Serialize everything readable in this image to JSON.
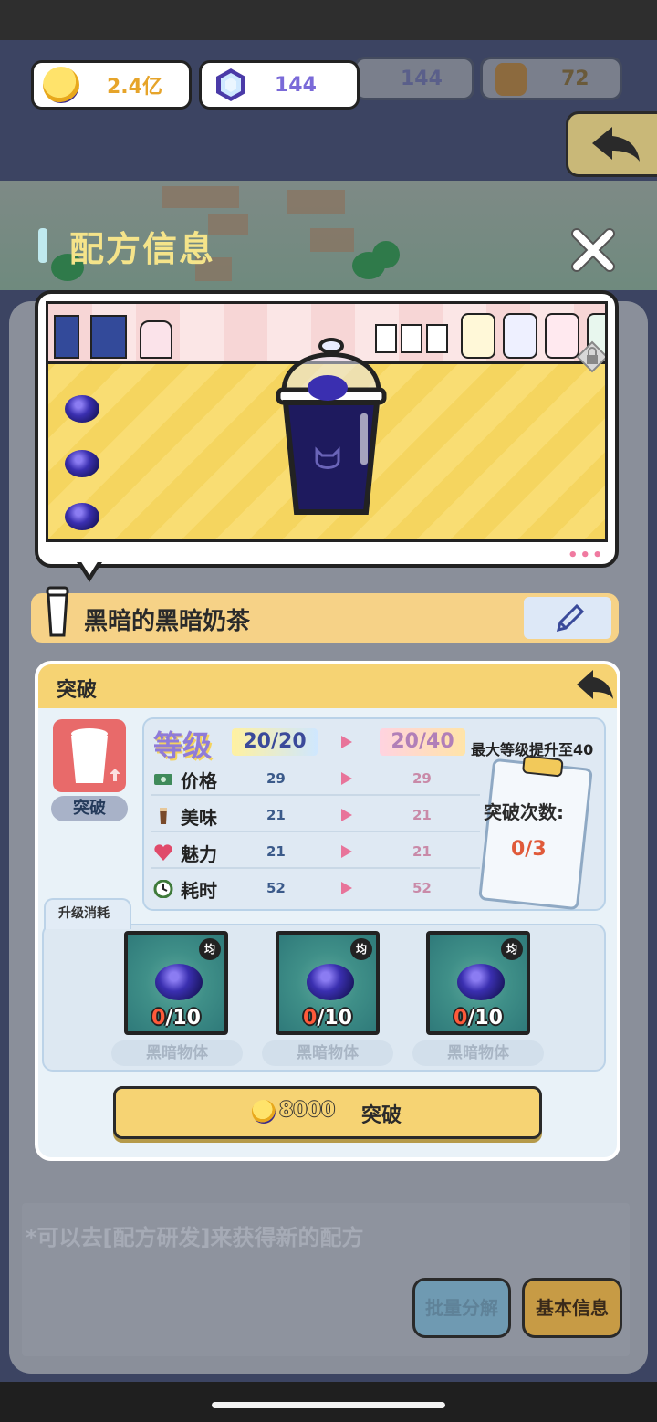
{
  "currency": {
    "gold": "2.4亿",
    "gems": "144",
    "dim_gems": "144",
    "dim_bags": "72"
  },
  "dialog": {
    "title": "配方信息"
  },
  "recipe": {
    "name": "黑暗的黑暗奶茶"
  },
  "breakthrough": {
    "title": "突破",
    "cup_label": "突破",
    "level_word": "等级",
    "level_current": "20/20",
    "level_new": "20/40",
    "max_level_text": "最大等级提升至40",
    "stats": [
      {
        "label": "价格",
        "icon": "money-icon",
        "current": "29",
        "new": "29"
      },
      {
        "label": "美味",
        "icon": "drink-icon",
        "current": "21",
        "new": "21"
      },
      {
        "label": "魅力",
        "icon": "heart-icon",
        "current": "21",
        "new": "21"
      },
      {
        "label": "耗时",
        "icon": "clock-icon",
        "current": "52",
        "new": "52"
      }
    ],
    "count_title": "突破次数:",
    "count_value": "0/3",
    "cost_label": "升级消耗",
    "materials": [
      {
        "have": "0",
        "need": "/10",
        "badge": "均",
        "name": "黑暗物体"
      },
      {
        "have": "0",
        "need": "/10",
        "badge": "均",
        "name": "黑暗物体"
      },
      {
        "have": "0",
        "need": "/10",
        "badge": "均",
        "name": "黑暗物体"
      }
    ],
    "button_cost": "8000",
    "button_label": "突破"
  },
  "background": {
    "hint": "*可以去[配方研发]来获得新的配方",
    "batch_button": "批量分解",
    "info_button": "基本信息"
  },
  "colors": {
    "accent_yellow": "#f6d373",
    "title_yellow": "#f5e48a",
    "highlight_red": "#e05a3a"
  }
}
